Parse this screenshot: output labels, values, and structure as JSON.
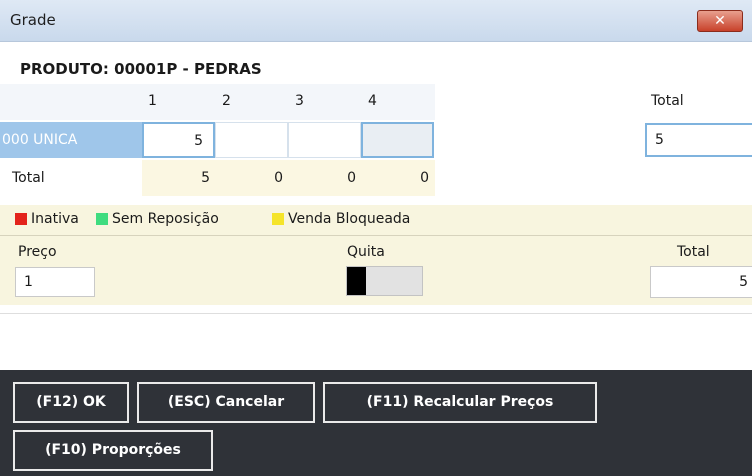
{
  "window": {
    "title": "Grade",
    "close_label": "✕"
  },
  "product": {
    "label": "PRODUTO: 00001P - PEDRAS"
  },
  "grid": {
    "columns": [
      "1",
      "2",
      "3",
      "4"
    ],
    "total_header": "Total",
    "row": {
      "label": "000 UNICA",
      "cells": [
        "5",
        "",
        "",
        ""
      ],
      "total": "5"
    },
    "totals": {
      "label": "Total",
      "values": [
        "5",
        "0",
        "0",
        "0"
      ]
    }
  },
  "legend": [
    {
      "label": "Inativa",
      "color": "#e3231b"
    },
    {
      "label": "Sem Reposição",
      "color": "#3fdc7f"
    },
    {
      "label": "Venda Bloqueada",
      "color": "#f5e42a"
    }
  ],
  "form": {
    "preco_label": "Preço",
    "preco_value": "1",
    "quita_label": "Quita",
    "total_label": "Total",
    "total_value": "5"
  },
  "buttons": {
    "ok": "(F12) OK",
    "cancel": "(ESC) Cancelar",
    "recalc": "(F11) Recalcular Preços",
    "proportions": "(F10) Proporções"
  }
}
